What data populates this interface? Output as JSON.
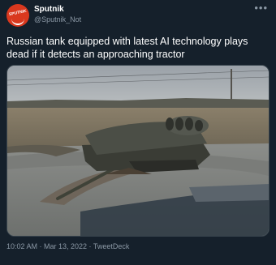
{
  "author": {
    "name": "Sputnik",
    "handle": "@Sputnik_Not",
    "avatar_text": "SPUTNIK",
    "avatar_icon": "sputnik-logo-icon",
    "avatar_color": "#d9381e"
  },
  "more_icon": "more-options-icon",
  "tweet": {
    "text": "Russian tank equipped with latest AI technology plays dead if it detects an approaching tractor"
  },
  "media": {
    "kind": "photo"
  },
  "meta": {
    "timestamp": "10:02 AM · Mar 13, 2022 · TweetDeck"
  },
  "colors": {
    "background": "#15202b",
    "primary_text": "#ffffff",
    "secondary_text": "#8b98a5",
    "border": "#38444d"
  }
}
